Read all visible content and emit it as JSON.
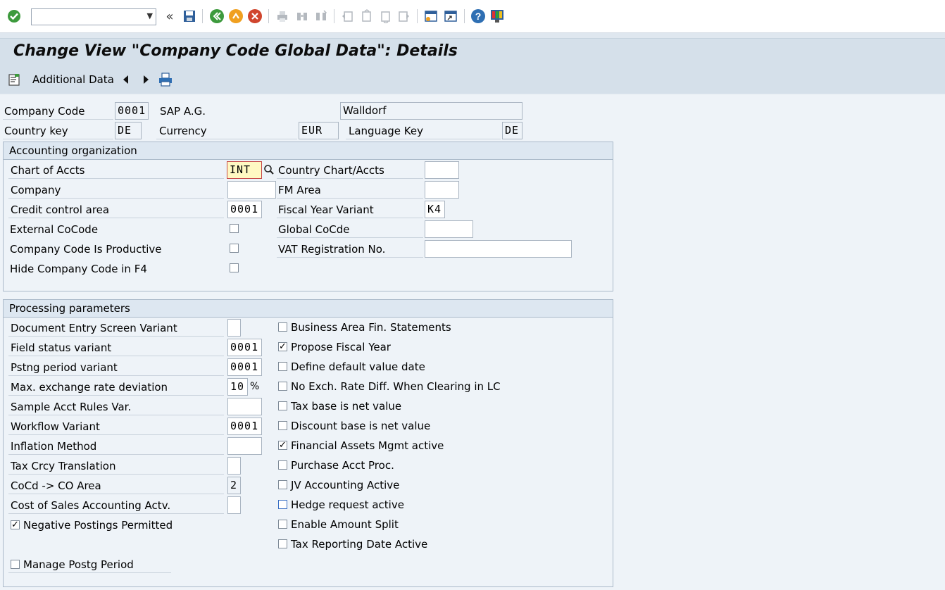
{
  "toolbar": {
    "command_field_value": "",
    "icons": [
      "enter-check-icon",
      "history-chevrons-icon",
      "save-icon",
      "back-icon",
      "exit-icon",
      "cancel-icon",
      "print-icon",
      "find-icon",
      "find-next-icon",
      "first-page-icon",
      "previous-page-icon",
      "next-page-icon",
      "last-page-icon",
      "new-session-icon",
      "shortcut-icon",
      "help-icon",
      "layout-menu-icon"
    ]
  },
  "title": "Change View \"Company Code Global Data\": Details",
  "app_toolbar": {
    "additional_data": "Additional Data"
  },
  "header": {
    "company_code_label": "Company Code",
    "company_code": "0001",
    "company_name": "SAP A.G.",
    "city": "Walldorf",
    "country_key_label": "Country key",
    "country_key": "DE",
    "currency_label": "Currency",
    "currency": "EUR",
    "language_key_label": "Language Key",
    "language_key": "DE"
  },
  "accounting": {
    "title": "Accounting organization",
    "chart_of_accts_label": "Chart of Accts",
    "chart_of_accts": "INT",
    "country_chart_label": "Country Chart/Accts",
    "country_chart": "",
    "company_label": "Company",
    "company": "",
    "fm_area_label": "FM Area",
    "fm_area": "",
    "credit_control_label": "Credit control area",
    "credit_control": "0001",
    "fiscal_year_variant_label": "Fiscal Year Variant",
    "fiscal_year_variant": "K4",
    "external_cocode_label": "External CoCode",
    "external_cocode_checked": false,
    "global_cocde_label": "Global CoCde",
    "global_cocde": "",
    "productive_label": "Company Code Is Productive",
    "productive_checked": false,
    "vat_label": "VAT Registration No.",
    "vat": "",
    "hide_f4_label": "Hide Company Code in F4",
    "hide_f4_checked": false
  },
  "processing": {
    "title": "Processing parameters",
    "doc_entry_label": "Document Entry Screen Variant",
    "doc_entry": "",
    "field_status_label": "Field status variant",
    "field_status": "0001",
    "pstng_period_label": "Pstng period variant",
    "pstng_period": "0001",
    "max_exch_label": "Max. exchange rate deviation",
    "max_exch": "10",
    "max_exch_unit": "%",
    "sample_acct_label": "Sample Acct Rules Var.",
    "sample_acct": "",
    "workflow_label": "Workflow Variant",
    "workflow": "0001",
    "inflation_label": "Inflation Method",
    "inflation": "",
    "tax_crcy_label": "Tax Crcy Translation",
    "tax_crcy": "",
    "cocd_co_label": "CoCd -> CO Area",
    "cocd_co": "2",
    "cost_sales_label": "Cost of Sales Accounting Actv.",
    "cost_sales": "",
    "negative_postings_label": "Negative Postings Permitted",
    "negative_postings_checked": true,
    "manage_postg_label": "Manage Postg Period",
    "manage_postg_checked": false,
    "right_checks": [
      {
        "label": "Business Area Fin. Statements",
        "checked": false
      },
      {
        "label": "Propose Fiscal Year",
        "checked": true
      },
      {
        "label": "Define default value date",
        "checked": false
      },
      {
        "label": "No Exch. Rate Diff. When Clearing in LC",
        "checked": false
      },
      {
        "label": "Tax base is net value",
        "checked": false
      },
      {
        "label": "Discount base is net value",
        "checked": false
      },
      {
        "label": "Financial Assets Mgmt active",
        "checked": true
      },
      {
        "label": "Purchase Acct Proc.",
        "checked": false
      },
      {
        "label": "JV Accounting Active",
        "checked": false
      },
      {
        "label": "Hedge request active",
        "checked": false
      },
      {
        "label": "Enable Amount Split",
        "checked": false
      },
      {
        "label": "Tax Reporting Date Active",
        "checked": false
      }
    ]
  }
}
